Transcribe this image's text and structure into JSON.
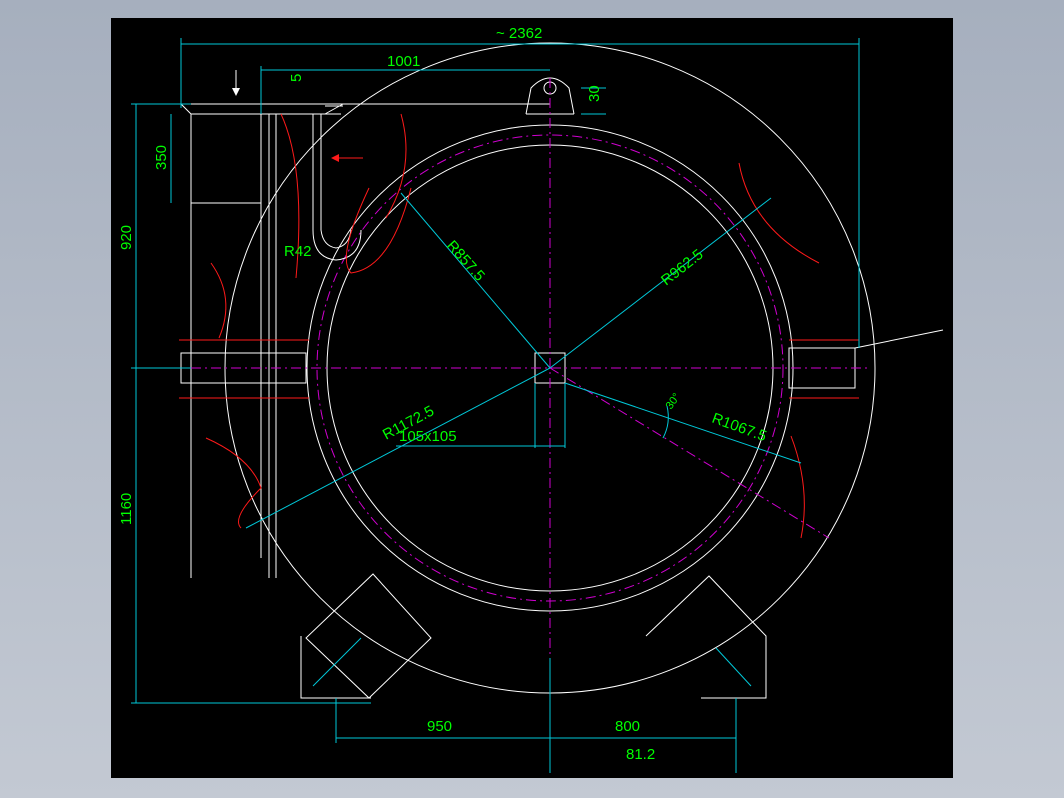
{
  "drawing": {
    "background": "#000000",
    "colors": {
      "dimension_text": "#00ff00",
      "dimension_line": "#00c8d8",
      "outline": "#ffffff",
      "centerline": "#d000d0",
      "hatch": "#ff1a1a"
    },
    "dimensions": {
      "overall_width": "~ 2362",
      "top_offset": "1001",
      "small_gap": "5",
      "lug_height": "30",
      "upper_height": "350",
      "upper_total": "920",
      "lower_total": "1160",
      "bottom_left": "950",
      "bottom_right": "800",
      "bottom_extra": "81.2",
      "radius_small": "R42",
      "radius_inner": "R857.5",
      "radius_mid": "R962.5",
      "radius_outer": "R1172.5",
      "radius_bolt": "R1067.5",
      "center_block": "105x105",
      "angle": "30°"
    }
  }
}
